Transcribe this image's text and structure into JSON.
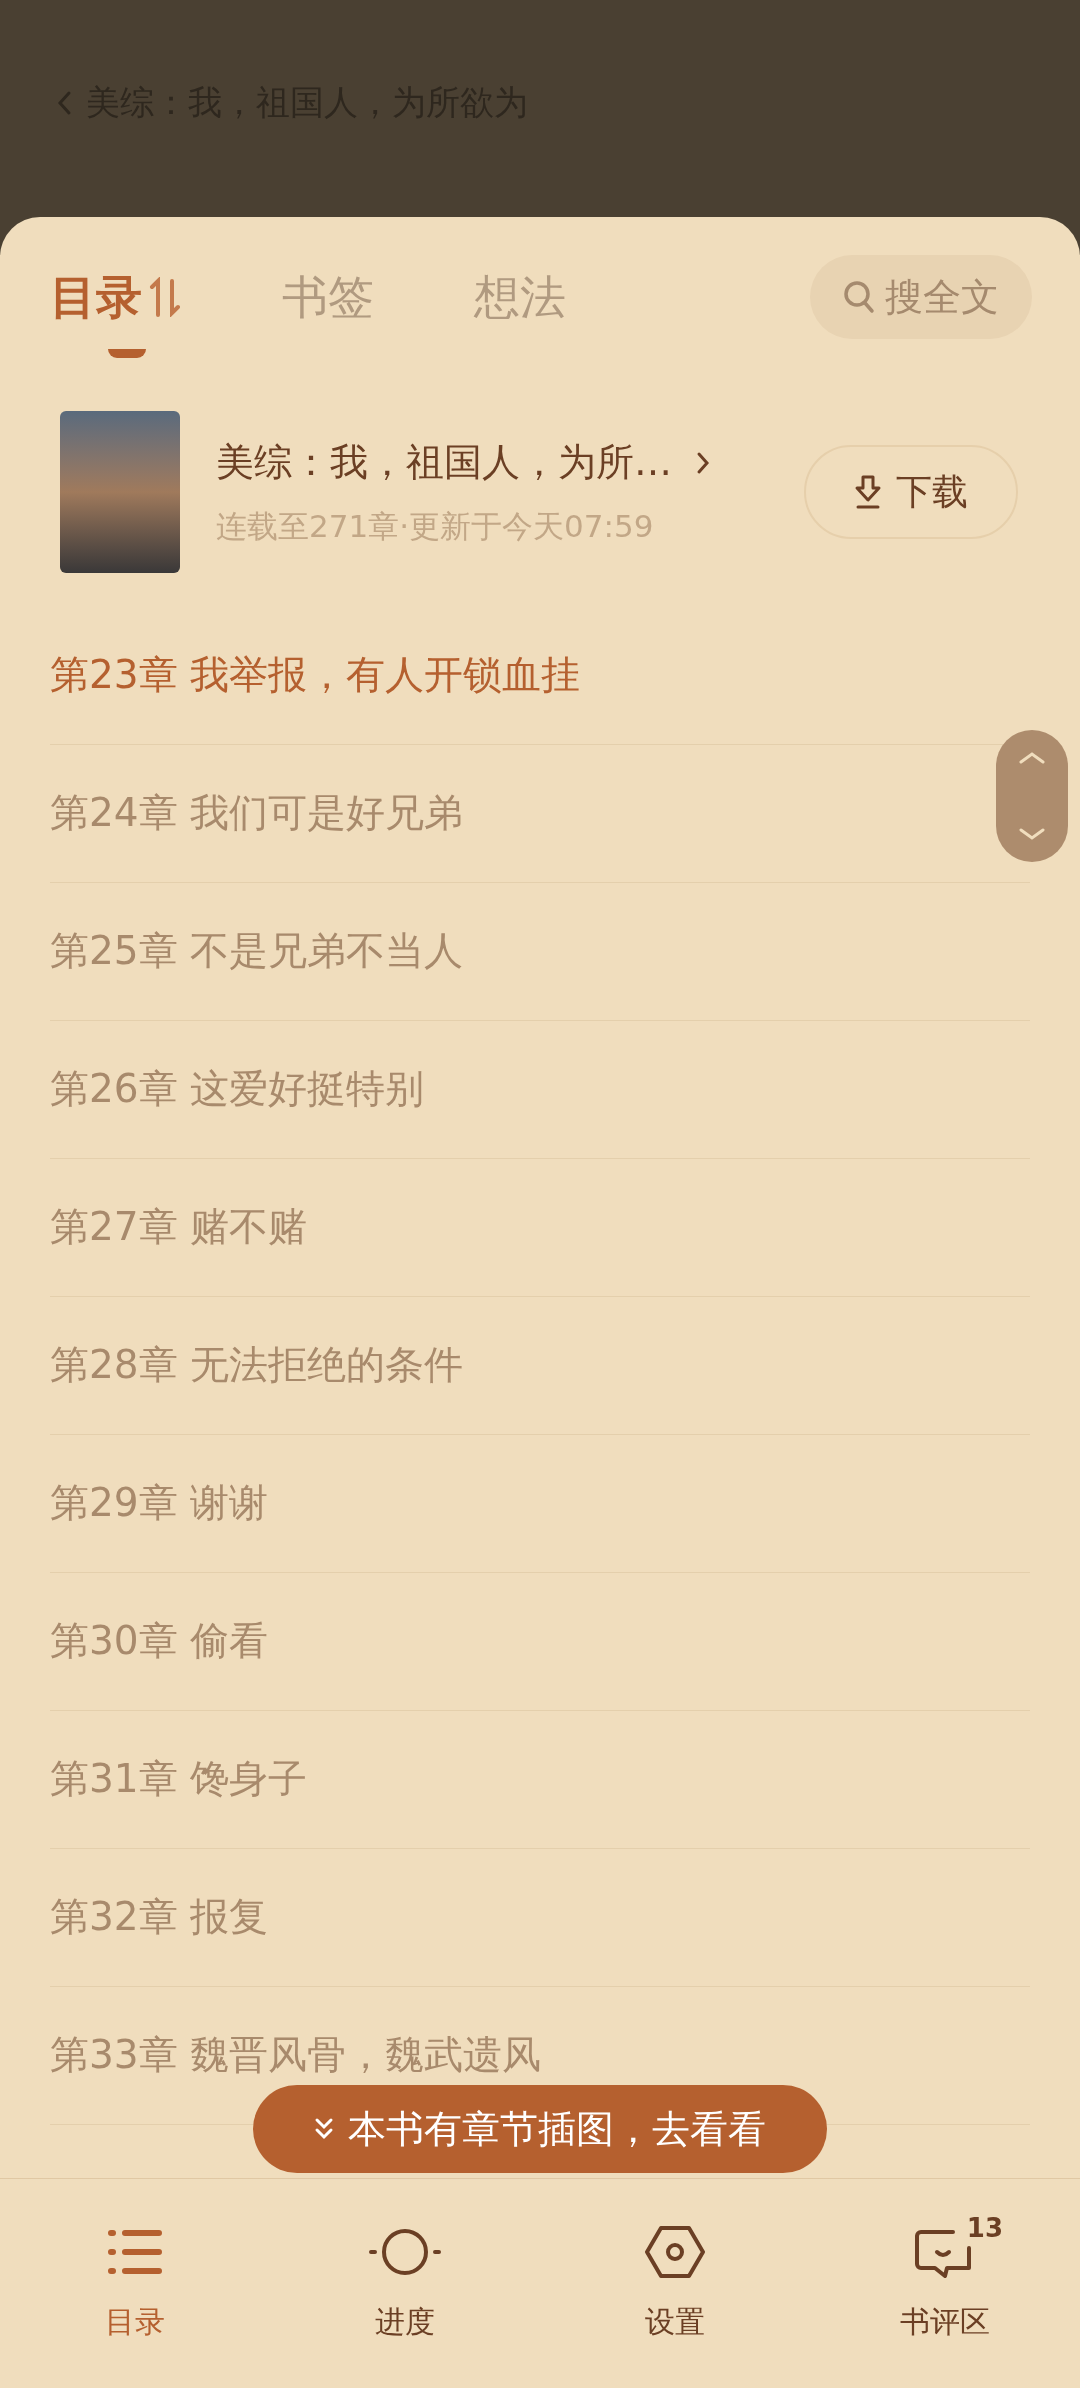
{
  "header": {
    "title": "美综：我，祖国人，为所欲为"
  },
  "tabs": [
    {
      "label": "目录",
      "selected": true
    },
    {
      "label": "书签",
      "selected": false
    },
    {
      "label": "想法",
      "selected": false
    }
  ],
  "search_button": {
    "label": "搜全文"
  },
  "book": {
    "title": "美综：我，祖国人，为所…",
    "subtitle": "连载至271章·更新于今天07:59",
    "download_button": "下载"
  },
  "chapters": [
    {
      "title": "第23章 我举报，有人开锁血挂",
      "current": true
    },
    {
      "title": "第24章 我们可是好兄弟",
      "current": false
    },
    {
      "title": "第25章 不是兄弟不当人",
      "current": false
    },
    {
      "title": "第26章 这爱好挺特别",
      "current": false
    },
    {
      "title": "第27章 赌不赌",
      "current": false
    },
    {
      "title": "第28章 无法拒绝的条件",
      "current": false
    },
    {
      "title": "第29章 谢谢",
      "current": false
    },
    {
      "title": "第30章 偷看",
      "current": false
    },
    {
      "title": "第31章 馋身子",
      "current": false
    },
    {
      "title": "第32章 报复",
      "current": false
    },
    {
      "title": "第33章 魏晋风骨，魏武遗风",
      "current": false
    }
  ],
  "banner": {
    "label": "本书有章节插图，去看看"
  },
  "nav": [
    {
      "kind": "contents",
      "label": "目录",
      "selected": true
    },
    {
      "kind": "progress",
      "label": "进度",
      "selected": false
    },
    {
      "kind": "settings",
      "label": "设置",
      "selected": false
    },
    {
      "kind": "comments",
      "label": "书评区",
      "selected": false,
      "badge": "13"
    }
  ]
}
